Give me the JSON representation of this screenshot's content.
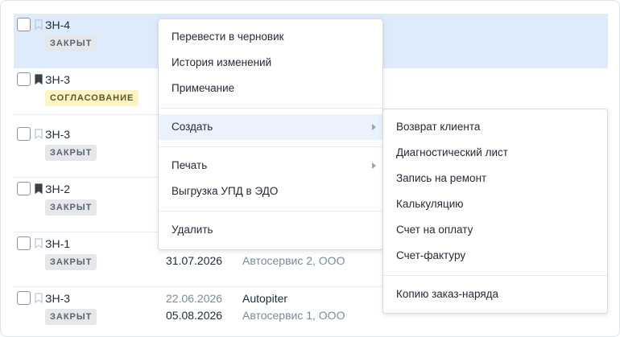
{
  "rows": [
    {
      "number": "ЗН-4",
      "status": "ЗАКРЫТ",
      "bookmarked": false,
      "selected": true
    },
    {
      "number": "ЗН-3",
      "status": "СОГЛАСОВАНИЕ",
      "bookmarked": true,
      "selected": false
    },
    {
      "number": "ЗН-3",
      "status": "ЗАКРЫТ",
      "bookmarked": false,
      "selected": false
    },
    {
      "number": "ЗН-2",
      "status": "ЗАКРЫТ",
      "bookmarked": true,
      "selected": false
    },
    {
      "number": "ЗН-1",
      "status": "ЗАКРЫТ",
      "bookmarked": false,
      "selected": false,
      "date2": "31.07.2026",
      "company": "Автосервис 2, ООО"
    },
    {
      "number": "ЗН-3",
      "status": "ЗАКРЫТ",
      "bookmarked": false,
      "selected": false,
      "date1": "22.06.2026",
      "date2": "05.08.2026",
      "client": "Autopiter",
      "company": "Автосервис 1, ООО"
    }
  ],
  "context_menu": {
    "items": [
      {
        "label": "Перевести в черновик"
      },
      {
        "label": "История изменений"
      },
      {
        "label": "Примечание"
      },
      {
        "label": "Создать",
        "submenu": true,
        "hover": true
      },
      {
        "label": "Печать",
        "submenu": true
      },
      {
        "label": "Выгрузка УПД в ЭДО"
      },
      {
        "label": "Удалить"
      }
    ]
  },
  "create_submenu": {
    "items": [
      {
        "label": "Возврат клиента"
      },
      {
        "label": "Диагностический лист"
      },
      {
        "label": "Запись на ремонт"
      },
      {
        "label": "Калькуляцию"
      },
      {
        "label": "Счет на оплату"
      },
      {
        "label": "Счет-фактуру"
      },
      {
        "label": "Копию заказ-наряда"
      }
    ]
  },
  "colors": {
    "selected_row": "#deebfb",
    "menu_hover": "#e9f2fd",
    "badge_closed": "#e5e7ea",
    "badge_approval": "#fdf4c4"
  },
  "icons": {
    "bookmark_empty": "bookmark-outline-icon",
    "bookmark_filled": "bookmark-filled-icon",
    "submenu_arrow": "chevron-right-icon"
  }
}
